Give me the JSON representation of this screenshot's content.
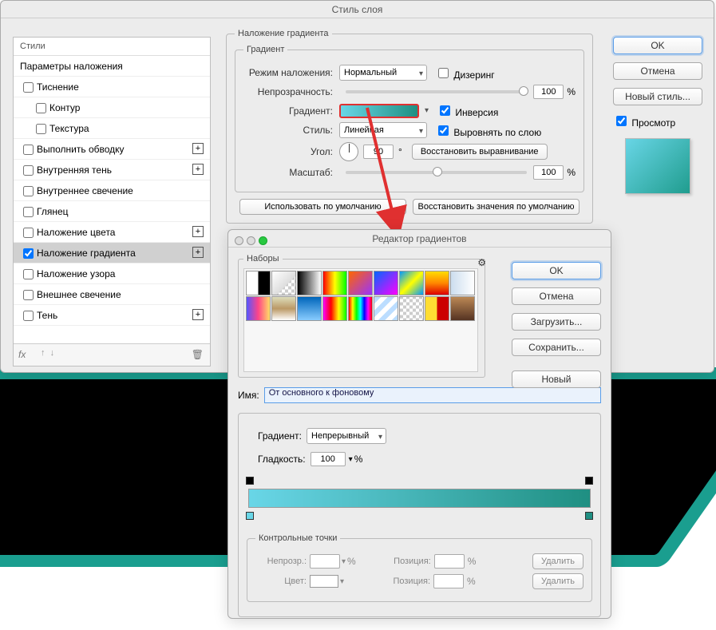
{
  "layerStyle": {
    "title": "Стиль слоя",
    "styles": {
      "header": "Стили",
      "blendingOptions": "Параметры наложения",
      "bevel": "Тиснение",
      "contour": "Контур",
      "texture": "Текстура",
      "stroke": "Выполнить обводку",
      "innerShadow": "Внутренняя тень",
      "innerGlow": "Внутреннее свечение",
      "satin": "Глянец",
      "colorOverlay": "Наложение цвета",
      "gradientOverlay": "Наложение градиента",
      "patternOverlay": "Наложение узора",
      "outerGlow": "Внешнее свечение",
      "dropShadow": "Тень",
      "fxLabel": "fx"
    },
    "overlay": {
      "groupTitle": "Наложение градиента",
      "gradientGroup": "Градиент",
      "blendModeLabel": "Режим наложения:",
      "blendModeValue": "Нормальный",
      "dither": "Дизеринг",
      "opacityLabel": "Непрозрачность:",
      "opacityValue": "100",
      "percent": "%",
      "gradientLabel": "Градиент:",
      "reverse": "Инверсия",
      "styleLabel": "Стиль:",
      "styleValue": "Линейная",
      "alignWithLayer": "Выровнять по слою",
      "angleLabel": "Угол:",
      "angleValue": "90",
      "degree": "°",
      "resetAlign": "Восстановить выравнивание",
      "scaleLabel": "Масштаб:",
      "scaleValue": "100",
      "makeDefault": "Использовать по умолчанию",
      "resetDefault": "Восстановить значения по умолчанию"
    },
    "buttons": {
      "ok": "OK",
      "cancel": "Отмена",
      "newStyle": "Новый стиль...",
      "preview": "Просмотр"
    }
  },
  "gradientEditor": {
    "title": "Редактор градиентов",
    "presetsLabel": "Наборы",
    "buttons": {
      "ok": "OK",
      "cancel": "Отмена",
      "load": "Загрузить...",
      "save": "Сохранить...",
      "new": "Новый"
    },
    "nameLabel": "Имя:",
    "nameValue": "От основного к фоновому",
    "gradTypeLabel": "Градиент:",
    "gradTypeValue": "Непрерывный",
    "smoothLabel": "Гладкость:",
    "smoothValue": "100",
    "percent": "%",
    "controlPoints": {
      "title": "Контрольные точки",
      "opacityLabel": "Непрозр.:",
      "positionLabel": "Позиция:",
      "colorLabel": "Цвет:",
      "delete": "Удалить"
    },
    "presets": [
      "linear-gradient(90deg,#fff 0%,#fff 50%,#000 50%,#000 100%)",
      "linear-gradient(135deg,#fff,#ddd 60%,transparent 60%),repeating-conic-gradient(#ccc 0 25%,#fff 0 50%) 0/8px 8px",
      "linear-gradient(90deg,#000,#fff)",
      "linear-gradient(90deg,#f00,#ff0,#0f0)",
      "linear-gradient(135deg,#f60,#93f)",
      "linear-gradient(135deg,#06f,#f0f)",
      "linear-gradient(135deg,#09f,#ff0,#09f)",
      "linear-gradient(180deg,#fd0,#f80,#d00)",
      "linear-gradient(90deg,#cde,#fff)",
      "linear-gradient(90deg,#55f,#f48,#fd6)",
      "linear-gradient(180deg,#ddb,#b96,#fff)",
      "linear-gradient(180deg,#06b,#8cf)",
      "linear-gradient(90deg,#f0f,#f00,#ff0,#0f0)",
      "linear-gradient(90deg,#f00,#ff0,#0f0,#0ff,#00f,#f0f,#f00)",
      "repeating-linear-gradient(135deg,#bdf 0 6px,#fff 6px 12px)",
      "repeating-conic-gradient(#ccc 0 25%,#fff 0 50%) 0/8px 8px",
      "linear-gradient(90deg,#fd3 0 50%,#c00 50% 100%)",
      "linear-gradient(180deg,#b85,#532)"
    ]
  }
}
